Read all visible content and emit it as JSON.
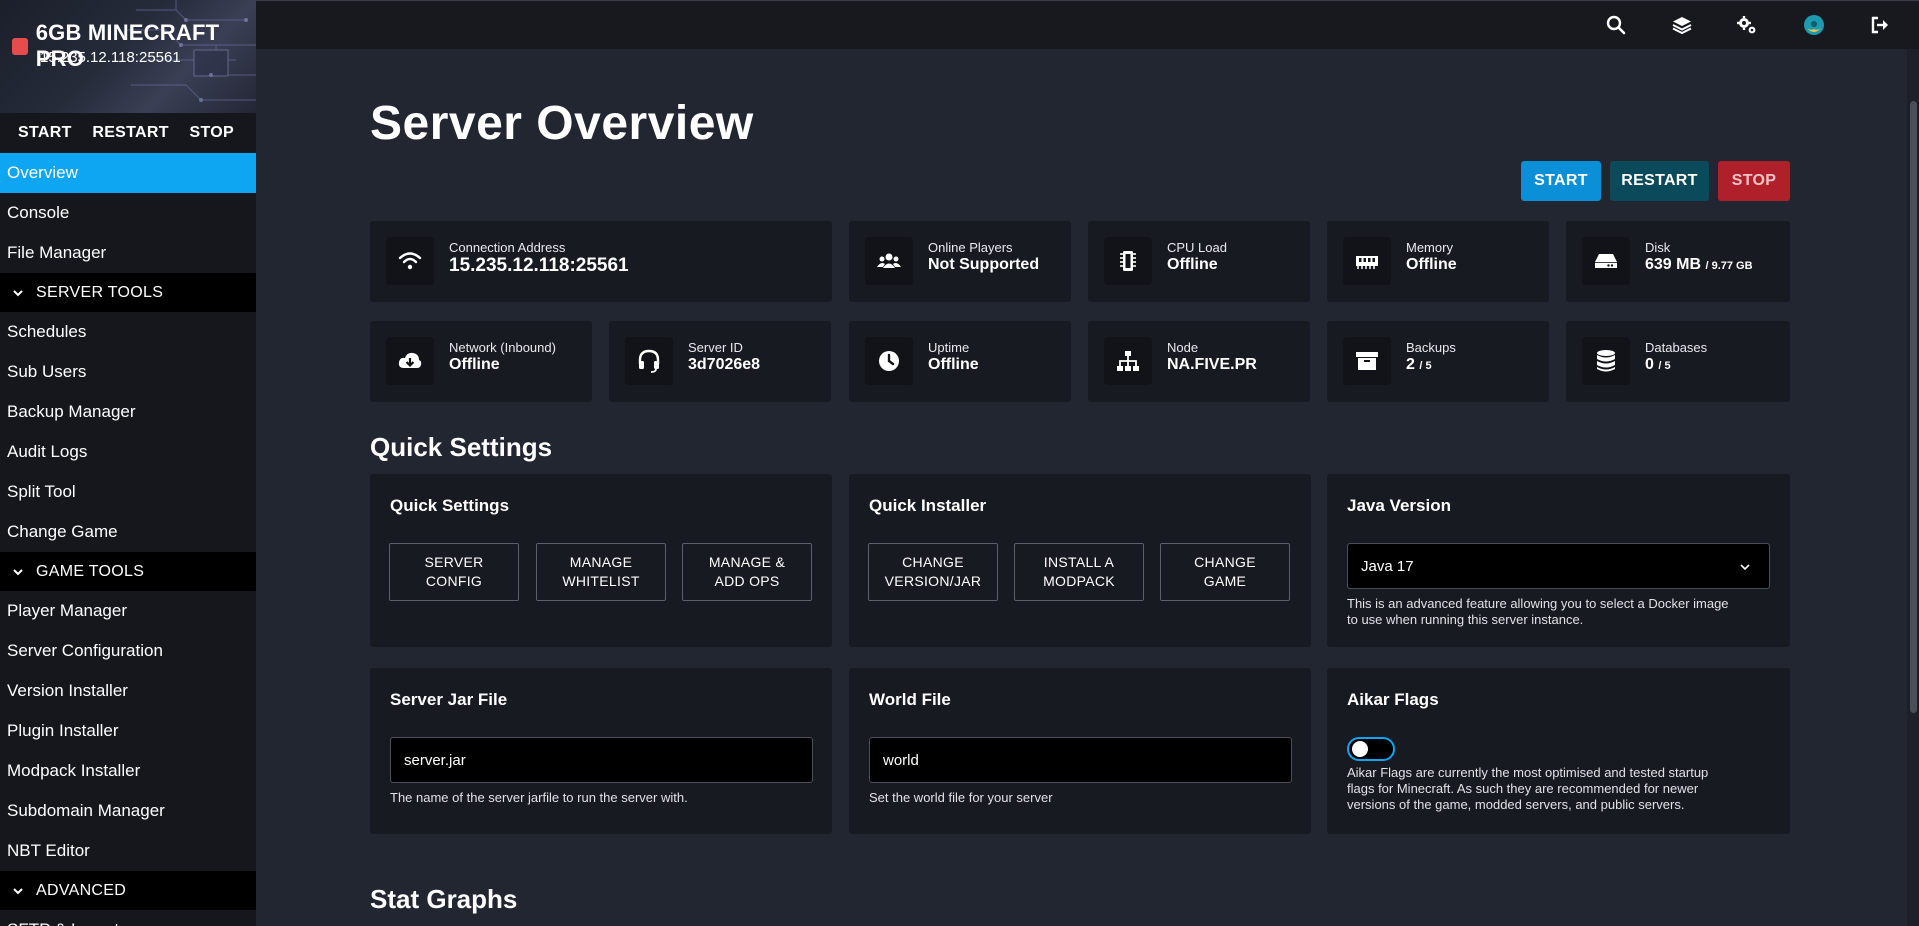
{
  "server": {
    "name": "6GB MINECRAFT PRO",
    "address": "15.235.12.118:25561",
    "status_color": "#e74c4c"
  },
  "sidebar": {
    "actions": {
      "start": "START",
      "restart": "RESTART",
      "stop": "STOP"
    },
    "items": [
      {
        "label": "Overview"
      },
      {
        "label": "Console"
      },
      {
        "label": "File Manager"
      },
      {
        "label": "SERVER TOOLS"
      },
      {
        "label": "Schedules"
      },
      {
        "label": "Sub Users"
      },
      {
        "label": "Backup Manager"
      },
      {
        "label": "Audit Logs"
      },
      {
        "label": "Split Tool"
      },
      {
        "label": "Change Game"
      },
      {
        "label": "GAME TOOLS"
      },
      {
        "label": "Player Manager"
      },
      {
        "label": "Server Configuration"
      },
      {
        "label": "Version Installer"
      },
      {
        "label": "Plugin Installer"
      },
      {
        "label": "Modpack Installer"
      },
      {
        "label": "Subdomain Manager"
      },
      {
        "label": "NBT Editor"
      },
      {
        "label": "ADVANCED"
      },
      {
        "label": "SFTP & Import"
      }
    ],
    "active_color": "#0ea5f2"
  },
  "topbar": {
    "icons": [
      "search-icon",
      "layers-icon",
      "settings-icon",
      "avatar",
      "logout-icon"
    ]
  },
  "main": {
    "title": "Server Overview",
    "buttons": {
      "start": "START",
      "restart": "RESTART",
      "stop": "STOP"
    },
    "stats": {
      "connection": {
        "label": "Connection Address",
        "value": "15.235.12.118:25561"
      },
      "players": {
        "label": "Online Players",
        "value": "Not Supported"
      },
      "cpu": {
        "label": "CPU Load",
        "value": "Offline"
      },
      "memory": {
        "label": "Memory",
        "value": "Offline"
      },
      "disk": {
        "label": "Disk",
        "value": "639 MB",
        "max": "/ 9.77 GB"
      },
      "network": {
        "label": "Network (Inbound)",
        "value": "Offline"
      },
      "server_id": {
        "label": "Server ID",
        "value": "3d7026e8"
      },
      "uptime": {
        "label": "Uptime",
        "value": "Offline"
      },
      "node": {
        "label": "Node",
        "value": "NA.FIVE.PR"
      },
      "backups": {
        "label": "Backups",
        "value": "2",
        "max": "/ 5"
      },
      "databases": {
        "label": "Databases",
        "value": "0",
        "max": "/ 5"
      }
    },
    "quick_settings_heading": "Quick Settings",
    "quick_settings": {
      "title": "Quick Settings",
      "buttons": [
        {
          "line1": "SERVER",
          "line2": "CONFIG"
        },
        {
          "line1": "MANAGE",
          "line2": "WHITELIST"
        },
        {
          "line1": "MANAGE &",
          "line2": "ADD OPS"
        }
      ]
    },
    "quick_installer": {
      "title": "Quick Installer",
      "buttons": [
        {
          "line1": "CHANGE",
          "line2": "VERSION/JAR"
        },
        {
          "line1": "INSTALL A",
          "line2": "MODPACK"
        },
        {
          "line1": "CHANGE",
          "line2": "GAME"
        }
      ]
    },
    "java_version": {
      "title": "Java Version",
      "selected": "Java 17",
      "help_line1": "This is an advanced feature allowing you to select a Docker image",
      "help_line2": "to use when running this server instance."
    },
    "server_jar": {
      "title": "Server Jar File",
      "value": "server.jar",
      "help": "The name of the server jarfile to run the server with."
    },
    "world_file": {
      "title": "World File",
      "value": "world",
      "help": "Set the world file for your server"
    },
    "aikar": {
      "title": "Aikar Flags",
      "enabled": false,
      "help_line1": "Aikar Flags are currently the most optimised and tested startup",
      "help_line2": "flags for Minecraft. As such they are recommended for newer",
      "help_line3": "versions of the game, modded servers, and public servers."
    },
    "stat_graphs_heading": "Stat Graphs"
  }
}
